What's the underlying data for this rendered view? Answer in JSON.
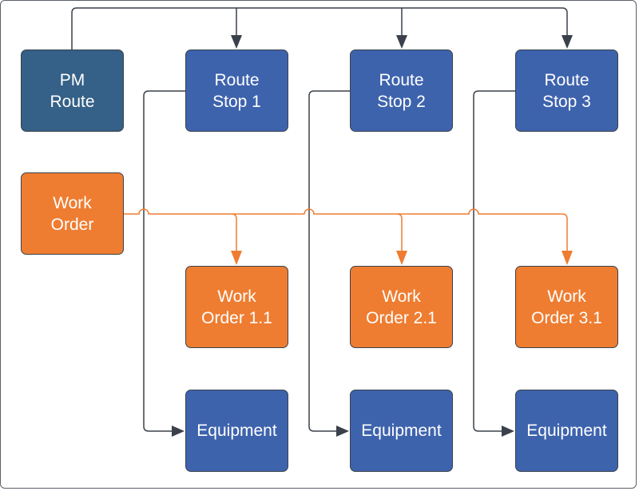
{
  "colors": {
    "pm_route": "#356087",
    "route_stop": "#3e63ad",
    "work_order": "#ee7d31",
    "connector": "#3a414a",
    "work_order_connector": "#ee7d31"
  },
  "nodes": {
    "pm_route": "PM\nRoute",
    "route_stops": [
      "Route\nStop 1",
      "Route\nStop 2",
      "Route\nStop 3"
    ],
    "work_order": "Work\nOrder",
    "work_orders": [
      "Work\nOrder 1.1",
      "Work\nOrder 2.1",
      "Work\nOrder 3.1"
    ],
    "equipment": [
      "Equipment",
      "Equipment",
      "Equipment"
    ]
  },
  "edges": [
    {
      "from": "PM Route",
      "to": "Route Stop 1"
    },
    {
      "from": "PM Route",
      "to": "Route Stop 2"
    },
    {
      "from": "PM Route",
      "to": "Route Stop 3"
    },
    {
      "from": "Work Order",
      "to": "Work Order 1.1"
    },
    {
      "from": "Work Order",
      "to": "Work Order 2.1"
    },
    {
      "from": "Work Order",
      "to": "Work Order 3.1"
    },
    {
      "from": "Route Stop 1",
      "to": "Equipment 1"
    },
    {
      "from": "Route Stop 2",
      "to": "Equipment 2"
    },
    {
      "from": "Route Stop 3",
      "to": "Equipment 3"
    }
  ]
}
